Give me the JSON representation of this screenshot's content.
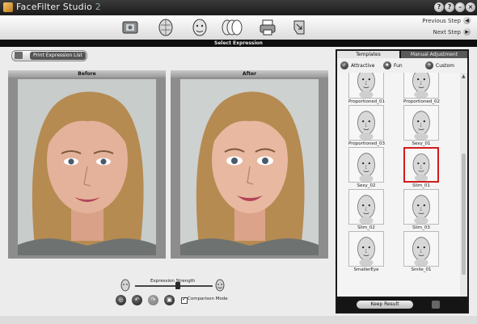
{
  "app": {
    "title": "FaceFilter Studio",
    "version": "2"
  },
  "window_controls": [
    "?",
    "?",
    "–",
    "×"
  ],
  "nav": {
    "previous": "Previous Step",
    "next": "Next Step"
  },
  "page_title": "Select Expression",
  "print_button": "Print Expression List",
  "panels": {
    "before": "Before",
    "after": "After"
  },
  "strength": {
    "label": "Expression Strength",
    "value": 0.52
  },
  "comparison_mode": {
    "label": "Comparison Mode",
    "checked": true
  },
  "tabs": {
    "templates": "Templates",
    "manual": "Manual Adjustment"
  },
  "filters": [
    {
      "label": "Attractive",
      "icon": "check"
    },
    {
      "label": "Fun",
      "icon": "star"
    },
    {
      "label": "Custom",
      "icon": "plus"
    }
  ],
  "templates": [
    {
      "name": "Proportioned_01"
    },
    {
      "name": "Proportioned_02"
    },
    {
      "name": "Proportioned_03"
    },
    {
      "name": "Sexy_01"
    },
    {
      "name": "Sexy_02"
    },
    {
      "name": "Slim_01",
      "selected": true
    },
    {
      "name": "Slim_02"
    },
    {
      "name": "Slim_03"
    },
    {
      "name": "SmallerEye"
    },
    {
      "name": "Smile_01"
    }
  ],
  "keep_result": "Keep Result",
  "colors": {
    "selection": "#d21b1b",
    "header": "#0e0e0e"
  }
}
